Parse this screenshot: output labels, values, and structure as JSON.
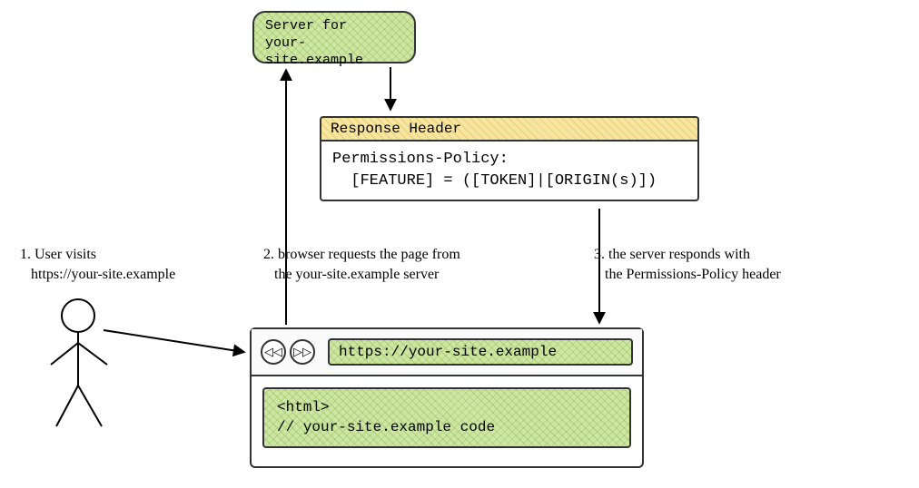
{
  "server": {
    "line1": "Server for",
    "line2": "your-site.example"
  },
  "response": {
    "title": "Response Header",
    "line1": "Permissions-Policy:",
    "line2": "  [FEATURE] = ([TOKEN]|[ORIGIN(s)])"
  },
  "steps": {
    "s1_line1": "1. User visits",
    "s1_line2": "   https://your-site.example",
    "s2_line1": "2. browser requests the page from",
    "s2_line2": "   the your-site.example server",
    "s3_line1": "3. the server responds with",
    "s3_line2": "   the Permissions-Policy header"
  },
  "browser": {
    "back_glyph": "◁◁",
    "forward_glyph": "▷▷",
    "url": "https://your-site.example",
    "code_line1": "<html>",
    "code_line2": "// your-site.example code"
  }
}
